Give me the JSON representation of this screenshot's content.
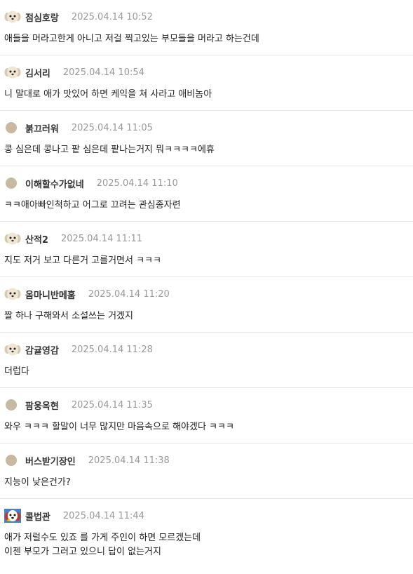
{
  "comments": [
    {
      "nickname": "점심호랑",
      "date": "2025.04.14 10:52",
      "text": "애들을 머라고한게 아니고 저걸 찍고있는 부모들을 머라고 하는건데",
      "avatar_icon": "puppy-face-icon"
    },
    {
      "nickname": "김서리",
      "date": "2025.04.14 10:54",
      "text": "니 말대로 애가 맛있어 하면 케익을 쳐 사라고 애비놈아",
      "avatar_icon": "puppy-face-icon"
    },
    {
      "nickname": "붉끄러워",
      "date": "2025.04.14 11:05",
      "text": "콩 심은데 콩나고 팥 심은데 팥나는거지 뭐ㅋㅋㅋㅋ에휴",
      "avatar_icon": "default-dot-icon"
    },
    {
      "nickname": "이해할수가없네",
      "date": "2025.04.14 11:10",
      "text": "ㅋㅋ애아빠인척하고 어그로 끄려는 관심종자련",
      "avatar_icon": "default-dot-icon"
    },
    {
      "nickname": "산적2",
      "date": "2025.04.14 11:11",
      "text": "지도 저거 보고 다른거 고를거면서 ㅋㅋㅋ",
      "avatar_icon": "puppy-face-icon"
    },
    {
      "nickname": "옴마니반메훔",
      "date": "2025.04.14 11:20",
      "text": "짤 하나 구해와서 소설쓰는 거겠지",
      "avatar_icon": "puppy-face-icon"
    },
    {
      "nickname": "감귤영감",
      "date": "2025.04.14 11:28",
      "text": "더럽다",
      "avatar_icon": "puppy-face-icon"
    },
    {
      "nickname": "팜웅옥현",
      "date": "2025.04.14 11:35",
      "text": "와우 ㅋㅋㅋ 할말이 너무 많지만 마음속으로 해야겠다 ㅋㅋㅋ",
      "avatar_icon": "default-dot-icon"
    },
    {
      "nickname": "버스받기장인",
      "date": "2025.04.14 11:38",
      "text": "지능이 낮은건가?",
      "avatar_icon": "default-dot-icon"
    },
    {
      "nickname": "콜법관",
      "date": "2025.04.14 11:44",
      "text": "애가 저럴수도 있죠 를 가게 주인이 하면 모르겠는데\n이젠 부모가 그러고 있으니 답이 없는거지",
      "avatar_icon": "colorful-dog-icon"
    }
  ],
  "colors": {
    "nickname": "#333333",
    "date": "#999999",
    "text": "#222222",
    "divider": "#e6e6e6",
    "dot_avatar": "#c9b9a0"
  }
}
